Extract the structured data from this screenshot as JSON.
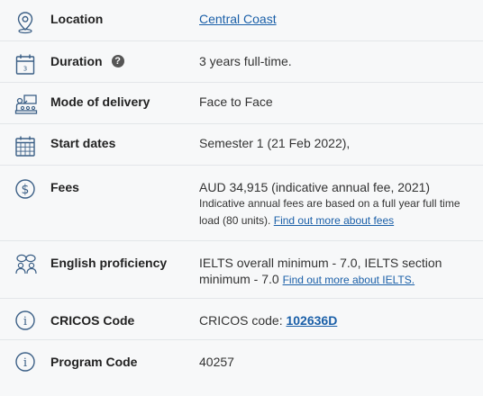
{
  "rows": {
    "location": {
      "label": "Location",
      "value_link": "Central Coast",
      "icon": "location-pin-icon"
    },
    "duration": {
      "label": "Duration",
      "help_icon": "question-circle-icon",
      "help_glyph": "?",
      "value": "3 years full-time.",
      "icon": "calendar-icon",
      "calendar_day": "3"
    },
    "mode": {
      "label": "Mode of delivery",
      "value": "Face to Face",
      "icon": "classroom-icon"
    },
    "start": {
      "label": "Start dates",
      "value": "Semester 1 (21 Feb 2022),",
      "icon": "calendar-grid-icon"
    },
    "fees": {
      "label": "Fees",
      "value": "AUD 34,915 (indicative annual fee, 2021)",
      "note": "Indicative annual fees are based on a full year full time load (80 units).",
      "note_link": "Find out more about fees",
      "icon": "dollar-circle-icon",
      "icon_glyph": "$"
    },
    "english": {
      "label": "English proficiency",
      "value": "IELTS overall minimum - 7.0, IELTS section minimum - 7.0",
      "value_link": "Find out more about IELTS.",
      "icon": "people-chat-icon"
    },
    "cricos": {
      "label": "CRICOS Code",
      "value_prefix": "CRICOS code:",
      "value_link": "102636D",
      "icon": "info-circle-icon",
      "icon_glyph": "i"
    },
    "program": {
      "label": "Program Code",
      "value": "40257",
      "icon": "info-circle-icon",
      "icon_glyph": "i"
    }
  },
  "colors": {
    "background": "#f7f8f9",
    "link": "#1a5fa8",
    "icon_stroke": "#3b5f86",
    "divider": "#e3e6e9"
  }
}
